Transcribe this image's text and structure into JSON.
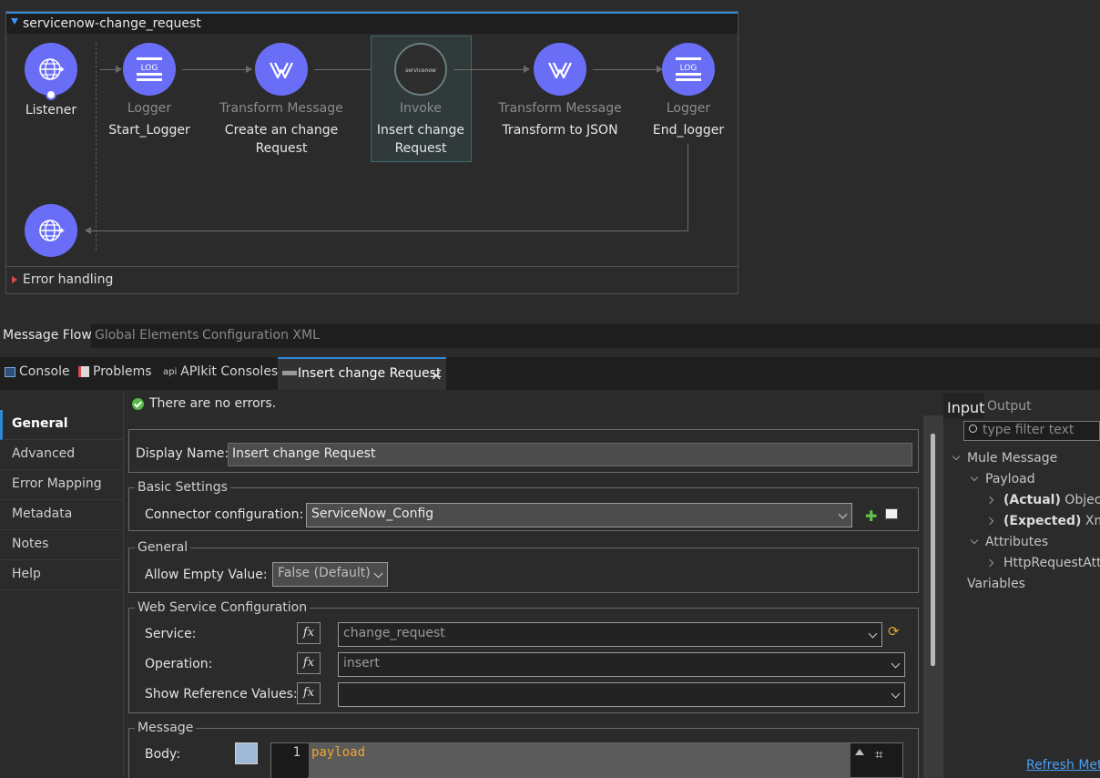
{
  "flow": {
    "title": "servicenow-change_request",
    "nodes": [
      {
        "type": "",
        "name": "Listener"
      },
      {
        "type": "Logger",
        "name": "Start_Logger"
      },
      {
        "type": "Transform Message",
        "name": "Create an change Request"
      },
      {
        "type": "Invoke",
        "name": "Insert change Request"
      },
      {
        "type": "Transform Message",
        "name": "Transform to JSON"
      },
      {
        "type": "Logger",
        "name": "End_logger"
      }
    ],
    "log_icon_text": "LOG",
    "servicenow_icon_text": "servicenow",
    "error_handling": "Error handling"
  },
  "editor_tabs": [
    "Message Flow",
    "Global Elements",
    "Configuration XML"
  ],
  "view_tabs": {
    "console": "Console",
    "problems": "Problems",
    "apikit_prefix": "api",
    "apikit": "APIkit Consoles",
    "active": "Insert change Request",
    "active_close": "×"
  },
  "side_nav": [
    "General",
    "Advanced",
    "Error Mapping",
    "Metadata",
    "Notes",
    "Help"
  ],
  "props": {
    "status": "There are no errors.",
    "display_name_label": "Display Name:",
    "display_name_value": "Insert change Request",
    "basic_settings": "Basic Settings",
    "connector_config_label": "Connector configuration:",
    "connector_config_value": "ServiceNow_Config",
    "general_group": "General",
    "allow_empty_label": "Allow Empty Value:",
    "allow_empty_value": "False (Default)",
    "ws_config": "Web Service Configuration",
    "service_label": "Service:",
    "service_value": "change_request",
    "operation_label": "Operation:",
    "operation_value": "insert",
    "show_ref_label": "Show Reference Values:",
    "show_ref_value": "",
    "fx": "fx",
    "message_group": "Message",
    "body_label": "Body:",
    "line_number": "1",
    "body_code": "payload"
  },
  "meta": {
    "tab_input": "Input",
    "tab_output": "Output",
    "filter_placeholder": "type filter text",
    "mule_message": "Mule Message",
    "payload": "Payload",
    "actual_bold": "(Actual)",
    "actual_type": " Object",
    "expected_bold": "(Expected)",
    "expected_type": " Xml",
    "attributes": "Attributes",
    "http_attr": "HttpRequestAttributes",
    "variables": "Variables",
    "refresh": "Refresh Metadata"
  },
  "colors": {
    "accent": "#2f87d6",
    "node": "#6a6ef7",
    "error": "#e04747",
    "ok": "#57b947",
    "code": "#f0a630"
  }
}
